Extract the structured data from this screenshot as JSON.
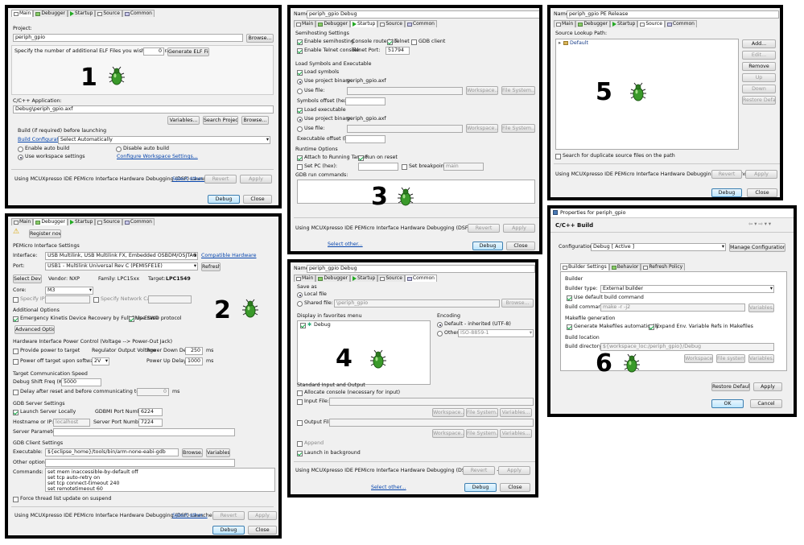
{
  "tabs": {
    "main": "Main",
    "debugger": "Debugger",
    "startup": "Startup",
    "source": "Source",
    "common": "Common"
  },
  "p1": {
    "project_label": "Project:",
    "project_value": "periph_gpio",
    "browse": "Browse...",
    "elf_label": "Specify the number of additional ELF Files you wish to program:",
    "elf_count": "0",
    "gen_elf": "Generate ELF Fields",
    "number": "1",
    "app_label": "C/C++ Application:",
    "app_value": "Debug\\periph_gpio.axf",
    "variables": "Variables...",
    "search_project": "Search Project...",
    "browse2": "Browse...",
    "build_label": "Build (if required) before launching",
    "build_config_link": "Build Configuration:",
    "build_config_value": "Select Automatically",
    "enable_auto": "Enable auto build",
    "disable_auto": "Disable auto build",
    "use_ws": "Use workspace settings",
    "configure_ws": "Configure Workspace Settings...",
    "launcher": "Using MCUXpresso IDE PEMicro Interface Hardware Debugging (DSF) Launcher -",
    "select_other": "Select other...",
    "revert": "Revert",
    "apply": "Apply",
    "debug": "Debug",
    "close": "Close"
  },
  "p2": {
    "register": "Register now",
    "pe_settings": "PEMicro Interface Settings",
    "interface_label": "Interface:",
    "interface_value": "USB Multilink, USB Multilink FX, Embedded OSBDM/OSJTAG - USB Port",
    "compatible": "Compatible Hardware",
    "port_label": "Port:",
    "port_value": "USB1 - Multilink Universal Rev C (PEMI5FE1E)",
    "refresh": "Refresh",
    "select_device": "Select Device",
    "vendor": "Vendor: NXP",
    "family": "Family: LPC15xx",
    "target_label": "Target:",
    "target_value": "LPC1549",
    "core_label": "Core:",
    "core_value": "M3",
    "specify_ip": "Specify IP",
    "specify_nc": "Specify Network Card IP",
    "number": "2",
    "additional": "Additional Options",
    "emergency": "Emergency Kinetis Device Recovery by Full Chip Erase",
    "swd": "Use SWD protocol",
    "adv_options": "Advanced Options",
    "hw_power": "Hardware Interface Power Control (Voltage --> Power-Out Jack)",
    "provide_power": "Provide power to target",
    "reg_output": "Regulator Output Voltage",
    "power_down_delay": "Power Down Delay",
    "pdd_value": "250",
    "ms": "ms",
    "power_off": "Power off target upon software exit",
    "voltage": "2V",
    "power_up_delay": "Power Up Delay",
    "pud_value": "1000",
    "target_comm": "Target Communication Speed",
    "shift_freq": "Debug Shift Freq (KHz)",
    "shift_value": "5000",
    "delay_reset": "Delay after reset and before communicating to target for",
    "delay_value": "0",
    "gdb_server": "GDB Server Settings",
    "launch_local": "Launch Server Locally",
    "gdbmi_label": "GDBMI Port Number:",
    "gdbmi_value": "6224",
    "host_label": "Hostname or IP:",
    "host_value": "localhost",
    "server_port_label": "Server Port Number:",
    "server_port_value": "7224",
    "server_params": "Server Parameters:",
    "gdb_client": "GDB Client Settings",
    "exe_label": "Executable:",
    "exe_value": "${eclipse_home}/tools/bin/arm-none-eabi-gdb",
    "browse": "Browse...",
    "variables": "Variables...",
    "other_opts": "Other options:",
    "commands": "Commands:",
    "cmd_lines": [
      "set mem inaccessible-by-default off",
      "set tcp auto-retry on",
      "set tcp connect-timeout 240",
      "set remotetimeout 60"
    ],
    "force_thread": "Force thread list update on suspend",
    "launcher": "Using MCUXpresso IDE PEMicro Interface Hardware Debugging (DSF) Launcher -",
    "select_other": "Select other...",
    "revert": "Revert",
    "apply": "Apply",
    "debug": "Debug",
    "close": "Close"
  },
  "p3": {
    "name_label": "Name:",
    "name_value": "periph_gpio Debug",
    "semihosting": "Semihosting Settings",
    "enable_semi": "Enable semihosting",
    "console_routed": "Console routed to:",
    "telnet": "Telnet",
    "gdb_client": "GDB client",
    "enable_telnet": "Enable Telnet console",
    "telnet_port_label": "Telnet Port:",
    "telnet_port": "51794",
    "load_symbols": "Load Symbols and Executable",
    "load_sym_cb": "Load symbols",
    "use_proj_bin": "Use project binary:",
    "bin_value": "periph_gpio.axf",
    "use_file": "Use file:",
    "workspace": "Workspace...",
    "filesystem": "File System...",
    "sym_offset": "Symbols offset (hex):",
    "load_exec": "Load executable",
    "exec_offset": "Executable offset (hex):",
    "runtime": "Runtime Options",
    "attach": "Attach to Running Target",
    "run_reset": "Run on reset",
    "set_pc": "Set PC (hex):",
    "set_bp": "Set breakpoint at:",
    "bp_value": "main",
    "gdb_cmds": "GDB run commands:",
    "number": "3",
    "launcher": "Using MCUXpresso IDE PEMicro Interface Hardware Debugging (DSF) Launcher -",
    "select_other": "Select other...",
    "revert": "Revert",
    "apply": "Apply",
    "debug": "Debug",
    "close": "Close"
  },
  "p4": {
    "name_label": "Name:",
    "name_value": "periph_gpio Debug",
    "save_as": "Save as",
    "local_file": "Local file",
    "shared_file": "Shared file:",
    "shared_value": "\\periph_gpio",
    "browse": "Browse...",
    "favorites": "Display in favorites menu",
    "fav_debug": "Debug",
    "encoding": "Encoding",
    "enc_default": "Default - inherited (UTF-8)",
    "enc_other": "Other",
    "enc_other_value": "ISO-8859-1",
    "number": "4",
    "std_io": "Standard Input and Output",
    "alloc_console": "Allocate console (necessary for input)",
    "input_file": "Input File:",
    "output_file": "Output File:",
    "workspace": "Workspace...",
    "filesystem": "File System...",
    "variables": "Variables...",
    "append": "Append",
    "launch_bg": "Launch in background",
    "launcher": "Using MCUXpresso IDE PEMicro Interface Hardware Debugging (DSF) Launcher -",
    "select_other": "Select other...",
    "revert": "Revert",
    "apply": "Apply",
    "debug": "Debug",
    "close": "Close"
  },
  "p5": {
    "name_label": "Name:",
    "name_value": "periph_gpio PE Release",
    "lookup": "Source Lookup Path:",
    "default_item": "Default",
    "add": "Add...",
    "edit": "Edit...",
    "remove": "Remove",
    "up": "Up",
    "down": "Down",
    "restore": "Restore Default",
    "number": "5",
    "dup_search": "Search for duplicate source files on the path",
    "launcher": "Using MCUXpresso IDE PEMicro Interface Hardware Debugging (DSF) Launcher",
    "revert": "Revert",
    "apply": "Apply",
    "debug": "Debug",
    "close": "Close"
  },
  "p6": {
    "title": "Properties for periph_gpio",
    "heading": "C/C++ Build",
    "config_label": "Configuration:",
    "config_value": "Debug  [ Active ]",
    "manage": "Manage Configurations...",
    "tab_builder": "Builder Settings",
    "tab_behavior": "Behavior",
    "tab_refresh": "Refresh Policy",
    "builder": "Builder",
    "builder_type_label": "Builder type:",
    "builder_type": "External builder",
    "use_default": "Use default build command",
    "build_cmd_label": "Build command:",
    "build_cmd": "make -r -j2",
    "variables": "Variables...",
    "makefile_gen": "Makefile generation",
    "gen_makefiles": "Generate Makefiles automatically",
    "expand_env": "Expand Env. Variable Refs in Makefiles",
    "build_loc": "Build location",
    "build_dir_label": "Build directory:",
    "build_dir": "${workspace_loc:/periph_gpio}/Debug",
    "workspace": "Workspace...",
    "filesystem": "File system...",
    "number": "6",
    "restore": "Restore Defaults",
    "apply": "Apply",
    "ok": "OK",
    "cancel": "Cancel"
  },
  "colors": {
    "bug_green": "#3a9a2a",
    "default_btn": "#bee6fd",
    "link": "#0645ad"
  }
}
